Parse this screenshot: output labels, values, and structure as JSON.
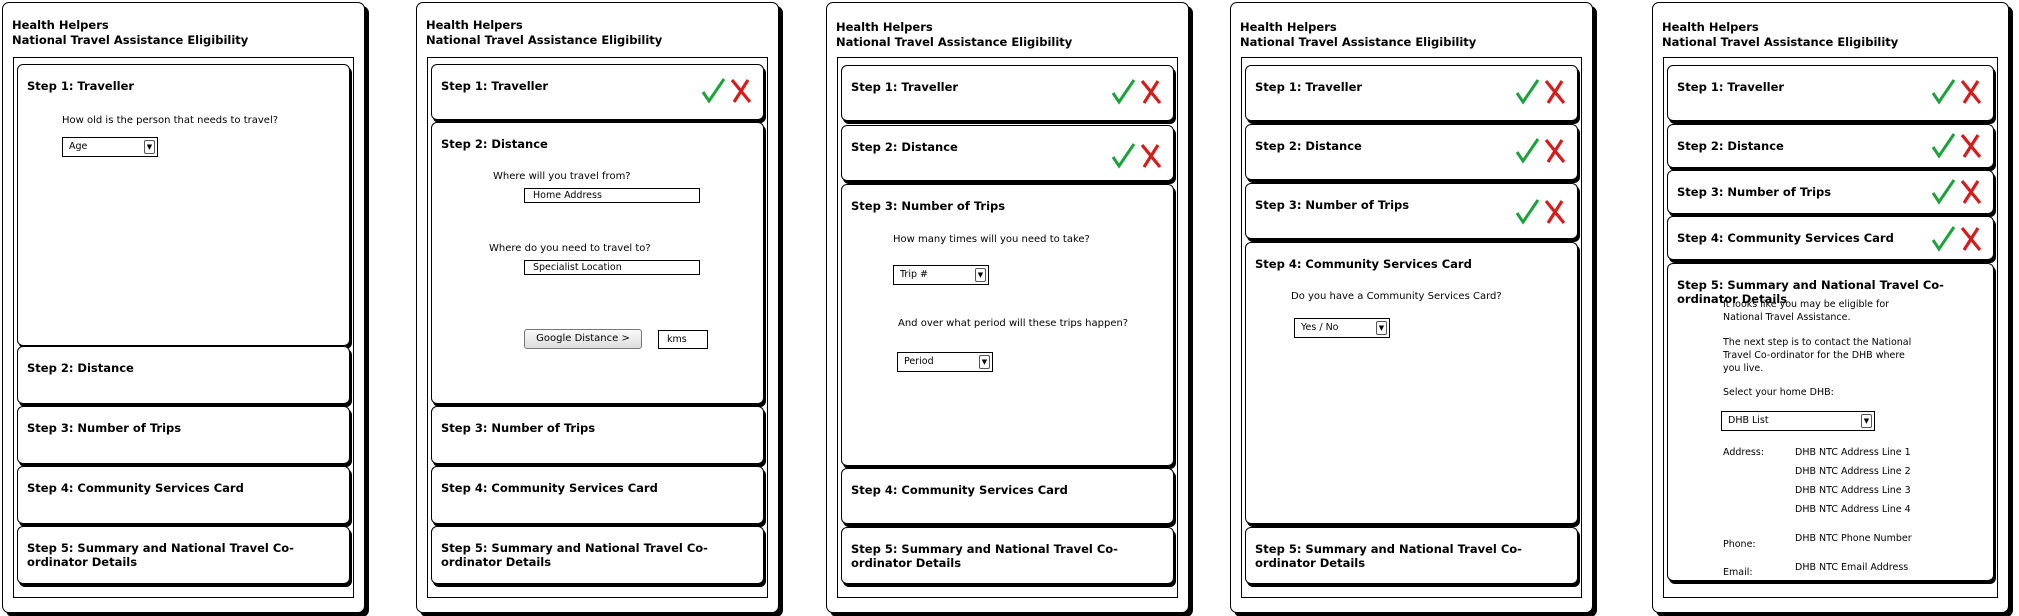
{
  "app": {
    "title": "Health Helpers",
    "subtitle": "National Travel Assistance Eligibility"
  },
  "steps": {
    "s1": "Step 1: Traveller",
    "s2": "Step 2: Distance",
    "s3": "Step 3: Number of Trips",
    "s4": "Step 4: Community Services Card",
    "s5": "Step 5: Summary and National Travel Co-ordinator Details"
  },
  "colors": {
    "check": "#1aa33a",
    "cross": "#d81b1b"
  },
  "icons": {
    "complete": "check-icon",
    "incomplete": "cross-icon",
    "dropdown": "chevron-down-icon"
  },
  "traveller": {
    "question": "How old is the person that needs to travel?",
    "age_select": "Age"
  },
  "distance": {
    "from_question": "Where will you travel from?",
    "from_value": "Home Address",
    "to_question": "Where do you need to travel to?",
    "to_value": "Specialist Location",
    "button": "Google Distance >",
    "kms": "kms"
  },
  "trips": {
    "q1": "How many times will you need to take?",
    "trip_select": "Trip #",
    "q2": "And over what period will these trips happen?",
    "period_select": "Period"
  },
  "csc": {
    "question": "Do you have a Community Services Card?",
    "select": "Yes / No"
  },
  "summary": {
    "p1a": "It looks like you may be eligible for",
    "p1b": "National Travel Assistance.",
    "p2a": "The next step is to contact the National",
    "p2b": "Travel Co-ordinator for the DHB where",
    "p2c": "you live.",
    "select_label": "Select your home DHB:",
    "dhb_select": "DHB List",
    "address_label": "Address:",
    "address_lines": [
      "DHB NTC Address Line 1",
      "DHB NTC Address Line 2",
      "DHB NTC Address Line 3",
      "DHB NTC Address Line 4"
    ],
    "phone_label": "Phone:",
    "phone": "DHB NTC Phone Number",
    "email_label": "Email:",
    "email": "DHB NTC Email Address"
  }
}
